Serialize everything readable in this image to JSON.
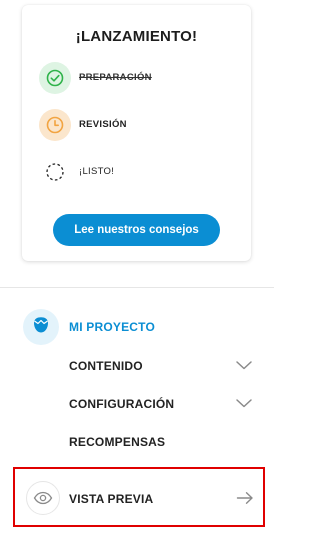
{
  "launch_card": {
    "title": "¡LANZAMIENTO!",
    "steps": [
      {
        "label": "PREPARACIÓN",
        "icon": "check-icon",
        "state": "done"
      },
      {
        "label": "REVISIÓN",
        "icon": "clock-icon",
        "state": "current"
      },
      {
        "label": "¡LISTO!",
        "icon": "dashed-circle-icon",
        "state": "pending"
      }
    ],
    "cta_label": "Lee nuestros consejos"
  },
  "project_nav": {
    "title": "MI PROYECTO",
    "items": [
      {
        "label": "CONTENIDO",
        "icon": "chevron-down-icon"
      },
      {
        "label": "CONFIGURACIÓN",
        "icon": "chevron-down-icon"
      },
      {
        "label": "RECOMPENSAS"
      }
    ],
    "preview": {
      "label": "VISTA PREVIA",
      "icon": "eye-icon",
      "action_icon": "arrow-right-icon"
    }
  },
  "colors": {
    "accent": "#0b8ed3",
    "done_green": "#2fb34a",
    "review_orange": "#f2a441",
    "highlight_border": "#e00000"
  }
}
